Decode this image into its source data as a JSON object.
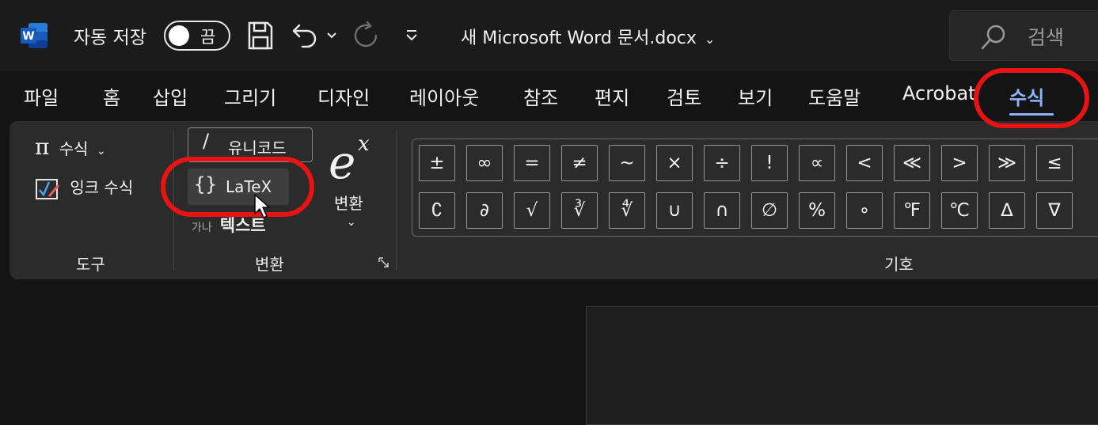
{
  "titlebar": {
    "app_icon": "word-icon",
    "autosave_label": "자동 저장",
    "autosave_state": "끔",
    "save_icon": "save-icon",
    "undo_icon": "undo-icon",
    "redo_icon": "redo-icon",
    "customize_icon": "customize-qat-icon",
    "doc_title": "새 Microsoft Word 문서.docx",
    "search_placeholder": "검색"
  },
  "tabs": [
    "파일",
    "홈",
    "삽입",
    "그리기",
    "디자인",
    "레이아웃",
    "참조",
    "편지",
    "검토",
    "보기",
    "도움말",
    "Acrobat",
    "수식"
  ],
  "active_tab": "수식",
  "ribbon": {
    "tools_group": {
      "equation_label": "수식",
      "ink_equation_label": "잉크 수식",
      "group_label": "도구"
    },
    "conversions_group": {
      "unicode_label": "유니코드",
      "latex_label": "LaTeX",
      "text_prefix": "가나",
      "text_label": "텍스트",
      "convert_label": "변환",
      "group_label": "변환"
    },
    "symbols_group": {
      "group_label": "기호",
      "row1": [
        "±",
        "∞",
        "=",
        "≠",
        "~",
        "×",
        "÷",
        "!",
        "∝",
        "<",
        "≪",
        ">",
        "≫",
        "≤"
      ],
      "row2": [
        "∁",
        "∂",
        "√",
        "∛",
        "∜",
        "∪",
        "∩",
        "∅",
        "%",
        "∘",
        "℉",
        "℃",
        "∆",
        "∇"
      ]
    }
  },
  "colors": {
    "highlight": "#e81313",
    "active_tab": "#8fb4ff",
    "ribbon_bg": "#2b2b2b",
    "app_bg": "#141414"
  }
}
